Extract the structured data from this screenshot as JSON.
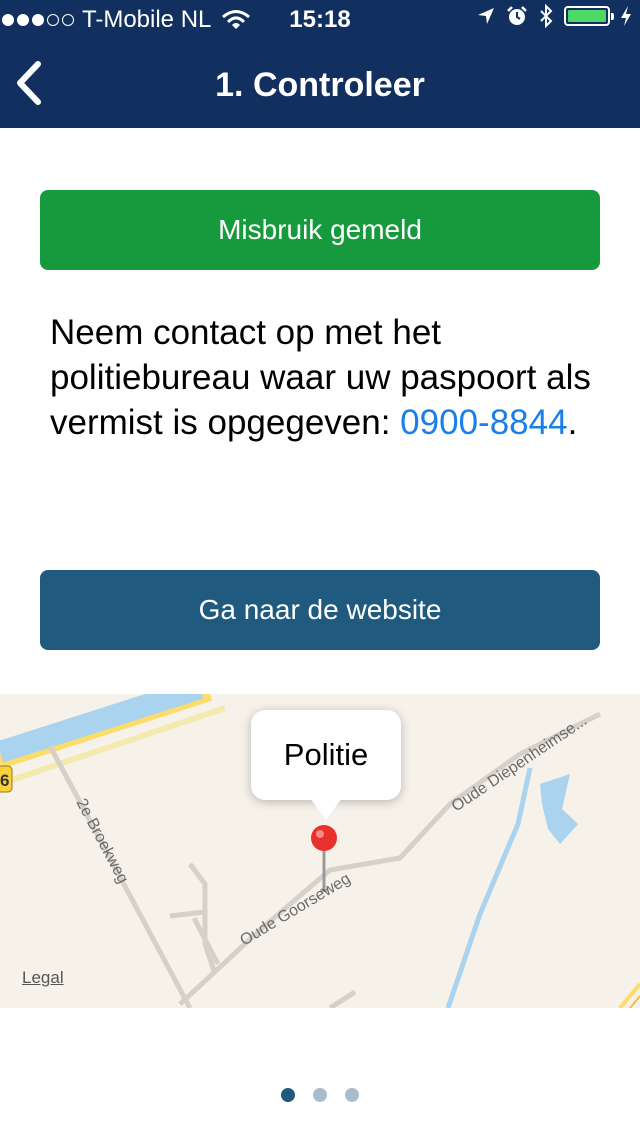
{
  "status_bar": {
    "carrier": "T-Mobile NL",
    "time": "15:18",
    "signal_bars_filled": 3,
    "signal_bars_total": 5,
    "battery_level": 1.0,
    "icons": [
      "wifi-icon",
      "location-arrow-icon",
      "alarm-icon",
      "bluetooth-icon",
      "battery-icon",
      "charging-bolt-icon"
    ]
  },
  "nav": {
    "title": "1. Controleer",
    "back_icon": "chevron-left-icon"
  },
  "status_button": {
    "label": "Misbruik gemeld",
    "color": "#17993e"
  },
  "info": {
    "text": "Neem contact op met het politiebureau waar uw paspoort als vermist is opgegeven: ",
    "phone": "0900-8844",
    "suffix": "."
  },
  "website_button": {
    "label": "Ga naar de website",
    "color": "#205b7f"
  },
  "map": {
    "pin_title": "Politie",
    "legal": "Legal",
    "road_labels": [
      "2e Broekweg",
      "Oude Goorseweg",
      "Oude Diepenheimse...",
      "6"
    ]
  },
  "pager": {
    "total": 3,
    "active_index": 0
  },
  "colors": {
    "header": "#12305f",
    "link": "#1a7fe8",
    "page_dot_active": "#205b7f",
    "page_dot_inactive": "#a9bccb"
  }
}
